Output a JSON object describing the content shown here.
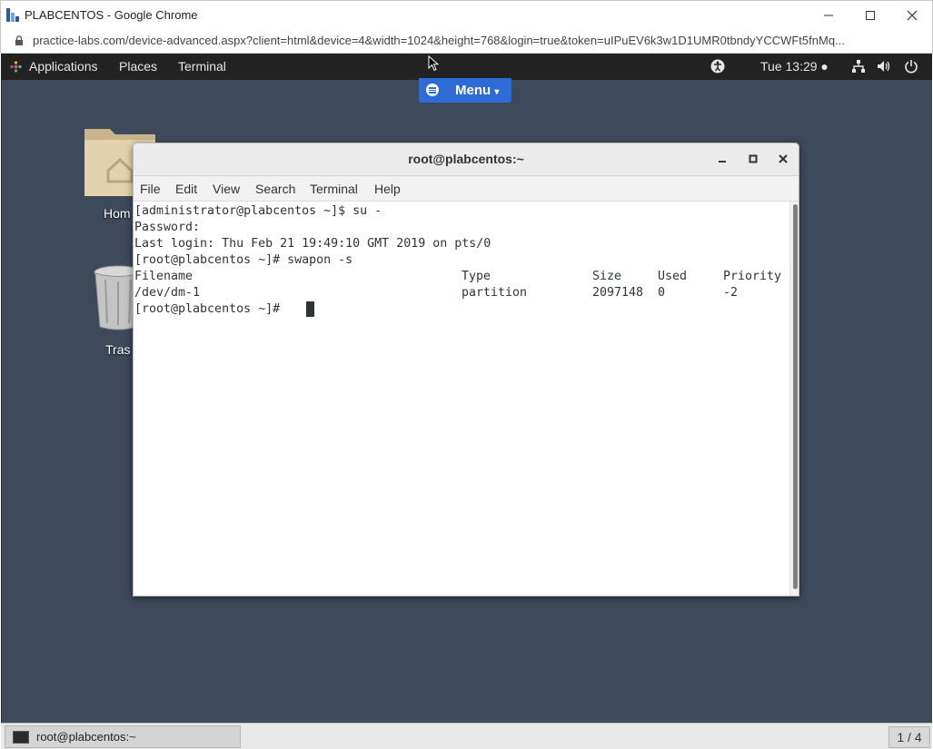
{
  "browser": {
    "window_title": "PLABCENTOS - Google Chrome",
    "url": "practice-labs.com/device-advanced.aspx?client=html&device=4&width=1024&height=768&login=true&token=uIPuEV6k3w1D1UMR0tbndyYCCWFt5fnMq..."
  },
  "gnome_topbar": {
    "applications": "Applications",
    "places": "Places",
    "terminal": "Terminal",
    "clock": "Tue 13:29 ●"
  },
  "menu_button": {
    "label": "Menu"
  },
  "desktop_icons": {
    "home_label": "Hom",
    "trash_label": "Tras"
  },
  "terminal": {
    "title": "root@plabcentos:~",
    "menu": [
      "File",
      "Edit",
      "View",
      "Search",
      "Terminal",
      "Help"
    ],
    "lines": [
      "[administrator@plabcentos ~]$ su -",
      "Password:",
      "Last login: Thu Feb 21 19:49:10 GMT 2019 on pts/0",
      "[root@plabcentos ~]# swapon -s"
    ],
    "swap_table": {
      "headers": [
        "Filename",
        "Type",
        "Size",
        "Used",
        "Priority"
      ],
      "row": [
        "/dev/dm-1",
        "partition",
        "2097148",
        "0",
        "-2"
      ]
    },
    "prompt": "[root@plabcentos ~]# "
  },
  "taskbar": {
    "task_label": "root@plabcentos:~",
    "workspace": "1 / 4"
  }
}
